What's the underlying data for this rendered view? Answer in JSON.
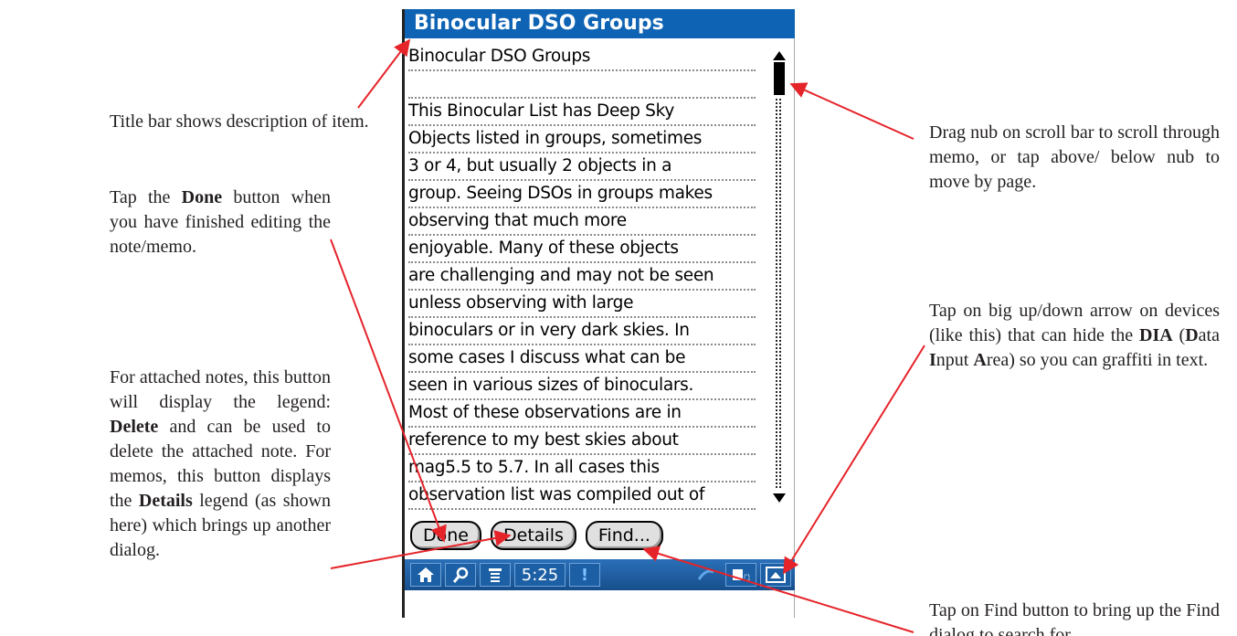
{
  "device": {
    "title": "Binocular DSO Groups",
    "memo_lines": [
      "Binocular DSO Groups",
      "",
      "This Binocular List has Deep Sky",
      "Objects listed in groups, sometimes",
      "3 or 4, but usually 2 objects in a",
      "group. Seeing DSOs in groups makes",
      "observing that much more",
      "enjoyable. Many of these objects",
      "are challenging and may not be seen",
      "unless observing with large",
      "binoculars or in very dark skies. In",
      "some cases I discuss what can be",
      "seen in various sizes of binoculars.",
      "Most of these observations are in",
      "reference to my best skies about",
      "mag5.5 to 5.7. In all cases this",
      "observation list was compiled out of"
    ],
    "buttons": {
      "done": "Done",
      "details": "Details",
      "find": "Find..."
    },
    "status_bar": {
      "clock": "5:25",
      "alert": "!",
      "icons": [
        "home-icon",
        "search-icon",
        "menu-icon",
        "alert-icon",
        "phone-icon",
        "input-area-icon",
        "dia-toggle-icon"
      ]
    }
  },
  "annotations": {
    "title_bar": "Title bar shows description of item.",
    "done_prefix": "Tap the ",
    "done_bold": "Done",
    "done_suffix": " button when you have finished editing the note/memo.",
    "details_1": "For attached notes, this button will display the legend: ",
    "details_bold1": "Delete",
    "details_2": " and can be used to delete the attached note. For memos, this button displays the ",
    "details_bold2": "Details",
    "details_3": " legend (as shown here) which brings up another dialog.",
    "scroll": "Drag nub on scroll bar to scroll through memo, or tap above/ below nub to move by page.",
    "dia_1": "Tap on big up/down arrow on devices (like this) that can hide the ",
    "dia_bold": "DIA",
    "dia_2": " (",
    "dia_d": "D",
    "dia_3": "ata ",
    "dia_i": "I",
    "dia_4": "nput ",
    "dia_a": "A",
    "dia_5": "rea) so you can graffiti in text.",
    "find": "Tap on Find button to bring up the Find dialog to search for"
  },
  "colors": {
    "title_bar": "#0e63b4",
    "leader_line": "#e5242a",
    "status_bar": "#1f5fa3"
  }
}
